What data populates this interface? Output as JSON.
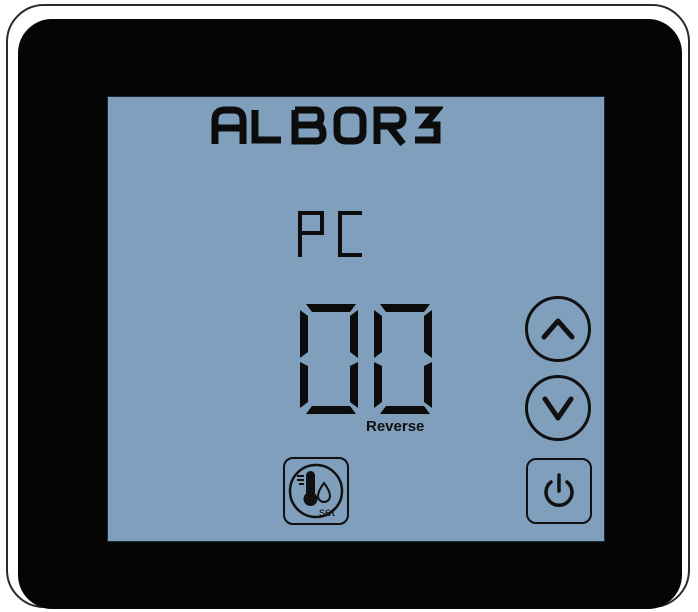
{
  "device": {
    "brand": "ALBORZ",
    "mode_code": "PC",
    "value_display": "00",
    "value_label": "Reverse"
  },
  "controls": {
    "up_icon": "chevron-up-icon",
    "down_icon": "chevron-down-icon",
    "power_icon": "power-icon",
    "set_icon": "thermometer-drop-icon",
    "set_label": "set"
  },
  "colors": {
    "bezel": "#050505",
    "lcd_background": "#7f9fbd",
    "segment": "#111111"
  }
}
